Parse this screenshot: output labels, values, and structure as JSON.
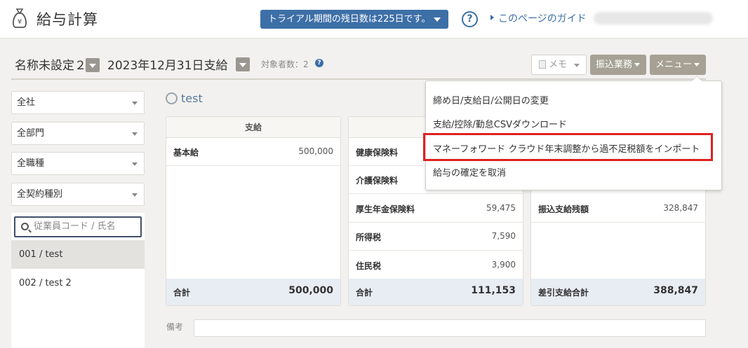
{
  "header": {
    "app_title": "給与計算",
    "trial_text": "トライアル期間の残日数は225日です。",
    "help_icon": "?",
    "guide_link": "このページのガイド"
  },
  "subbar": {
    "period_name": "名称未設定２",
    "pay_date": "2023年12月31日支給",
    "target_count": "対象者数：2",
    "memo_button": "メモ",
    "furikomi_button": "振込業務",
    "menu_button": "メニュー"
  },
  "filters": [
    "全社",
    "全部門",
    "全職種",
    "全契約種別"
  ],
  "search": {
    "placeholder": "従業員コード / 氏名"
  },
  "employees": [
    "001 / test",
    "002 / test 2"
  ],
  "employee_name": "test",
  "cards": {
    "pay": {
      "title": "支給",
      "rows": [
        {
          "label": "基本給",
          "value": "500,000"
        }
      ],
      "total_label": "合計",
      "total_value": "500,000"
    },
    "deduction": {
      "rows": [
        {
          "label": "健康保険料",
          "value": ""
        },
        {
          "label": "介護保険料",
          "value": ""
        },
        {
          "label": "厚生年金保険料",
          "value": "59,475"
        },
        {
          "label": "所得税",
          "value": "7,590"
        },
        {
          "label": "住民税",
          "value": "3,900"
        }
      ],
      "total_label": "合計",
      "total_value": "111,153"
    },
    "net": {
      "rows": [
        {
          "label": "振込支給残額",
          "value": "328,847"
        }
      ],
      "total_label": "差引支給合計",
      "total_value": "388,847"
    }
  },
  "biko_label": "備考",
  "menu": {
    "items": [
      "締め日/支給日/公開日の変更",
      "支給/控除/勤怠CSVダウンロード",
      "マネーフォワード クラウド年末調整から過不足税額をインポート",
      "給与の確定を取消"
    ]
  },
  "colors": {
    "accent_blue": "#3d6fa7",
    "highlight_red": "#e02020",
    "button_khaki": "#a6a194"
  }
}
